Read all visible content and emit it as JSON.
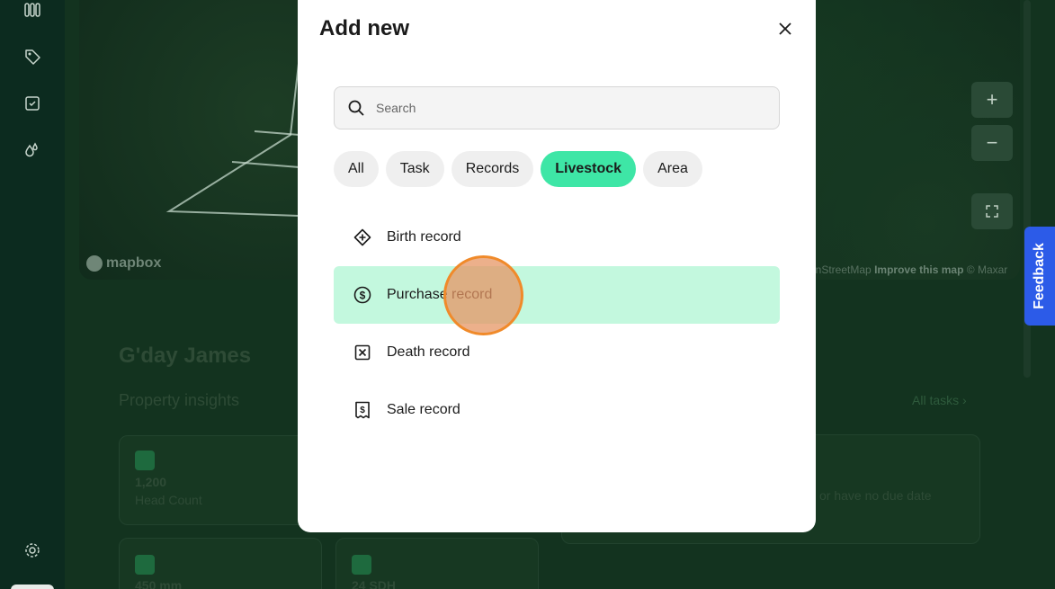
{
  "sidebar": {
    "icons": [
      "columns-icon",
      "tag-icon",
      "checkbox-icon",
      "droplets-icon",
      "gear-icon"
    ]
  },
  "map": {
    "logo": "mapbox",
    "attribution_prefix": "enStreetMap",
    "attribution_link": "Improve this map",
    "attribution_suffix": "© Maxar",
    "zoom_in": "+",
    "zoom_out": "−"
  },
  "feedback_label": "Feedback",
  "dashboard": {
    "greeting": "G'day James",
    "insights_heading": "Property insights",
    "all_tasks": "All tasks",
    "cards": [
      {
        "value": "1,200",
        "label": "Head Count"
      },
      {
        "value": "450  mm",
        "label": ""
      },
      {
        "value": "24  SDH",
        "label": ""
      }
    ],
    "tasks_text": "or have no due date"
  },
  "modal": {
    "title": "Add new",
    "search_placeholder": "Search",
    "chips": [
      {
        "label": "All",
        "active": false
      },
      {
        "label": "Task",
        "active": false
      },
      {
        "label": "Records",
        "active": false
      },
      {
        "label": "Livestock",
        "active": true
      },
      {
        "label": "Area",
        "active": false
      }
    ],
    "items": [
      {
        "label": "Birth record",
        "icon": "birth-icon"
      },
      {
        "label": "Purchase record",
        "icon": "dollar-circle-icon"
      },
      {
        "label": "Death record",
        "icon": "x-square-icon"
      },
      {
        "label": "Sale record",
        "icon": "receipt-dollar-icon"
      }
    ]
  },
  "colors": {
    "accent": "#3ee6a6",
    "hover": "#c3f8de",
    "feedback": "#2c5be8"
  }
}
